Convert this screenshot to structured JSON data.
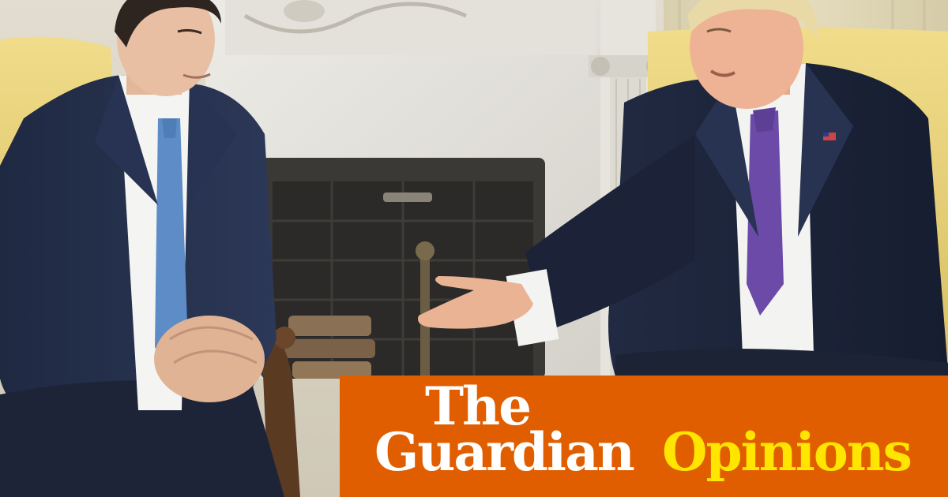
{
  "banner": {
    "line1": "The",
    "line2": "Guardian",
    "section": "Opinions",
    "background_color": "#e05e00",
    "text_color": "#ffffff",
    "section_color": "#ffe500"
  }
}
